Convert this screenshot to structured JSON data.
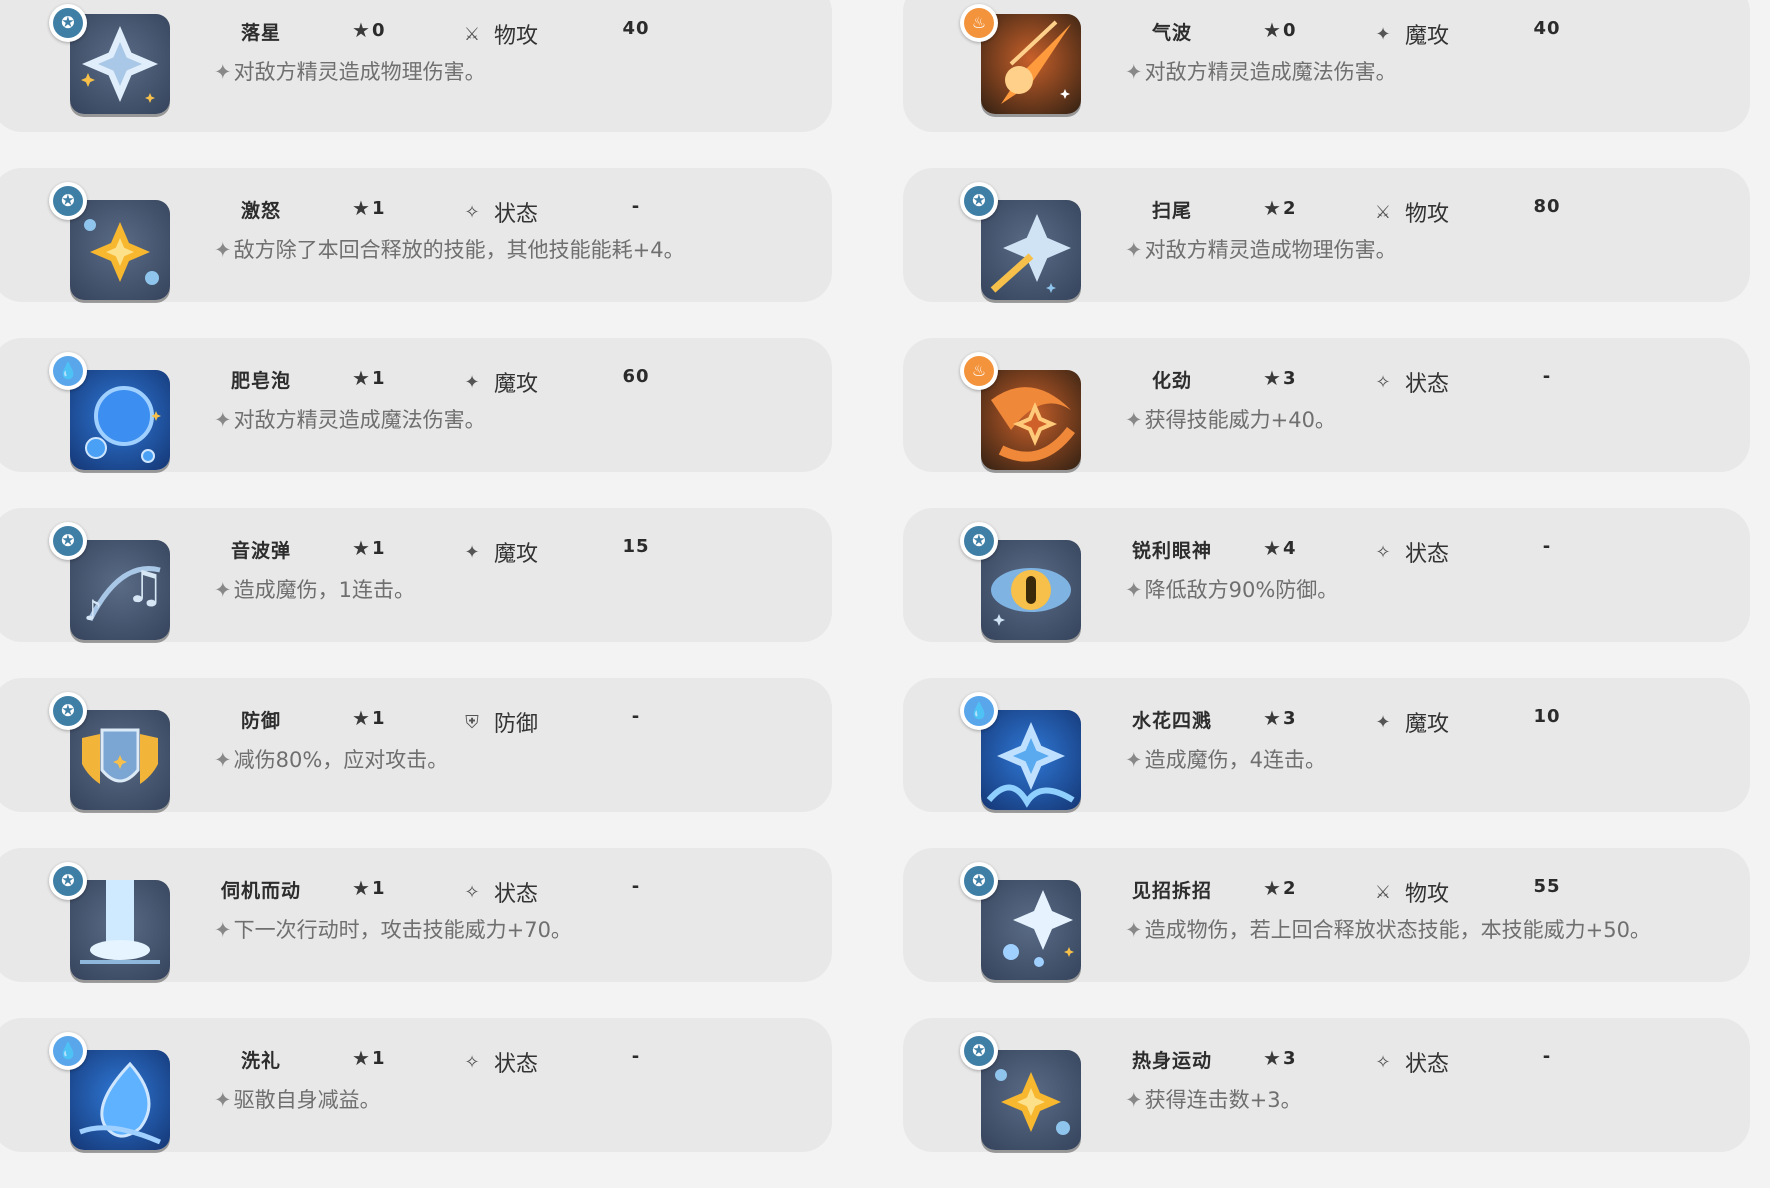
{
  "colors": {
    "card": "#e8e8e8",
    "background": "#f3f3f3",
    "badge_normal": "#3f7fa6",
    "badge_fire": "#f3943d",
    "badge_water": "#5aa6ea"
  },
  "left": [
    {
      "name": "落星",
      "cost": "0",
      "category": "物攻",
      "category_icon": "sword-icon",
      "power": "40",
      "desc": "对敌方精灵造成物理伤害。",
      "element": "normal",
      "art": "star-shatter"
    },
    {
      "name": "激怒",
      "cost": "1",
      "category": "状态",
      "category_icon": "sparkle-icon",
      "power": "-",
      "desc": "敌方除了本回合释放的技能，其他技能能耗+4。",
      "element": "normal",
      "art": "yellow-star"
    },
    {
      "name": "肥皂泡",
      "cost": "1",
      "category": "魔攻",
      "category_icon": "wand-icon",
      "power": "60",
      "desc": "对敌方精灵造成魔法伤害。",
      "element": "water",
      "art": "bubble"
    },
    {
      "name": "音波弹",
      "cost": "1",
      "category": "魔攻",
      "category_icon": "wand-icon",
      "power": "15",
      "desc": "造成魔伤，1连击。",
      "element": "normal",
      "art": "music"
    },
    {
      "name": "防御",
      "cost": "1",
      "category": "防御",
      "category_icon": "shield-icon",
      "power": "-",
      "desc": "减伤80%，应对攻击。",
      "element": "normal",
      "art": "shield"
    },
    {
      "name": "伺机而动",
      "cost": "1",
      "category": "状态",
      "category_icon": "sparkle-icon",
      "power": "-",
      "desc": "下一次行动时，攻击技能威力+70。",
      "element": "normal",
      "art": "light-beam"
    },
    {
      "name": "洗礼",
      "cost": "1",
      "category": "状态",
      "category_icon": "sparkle-icon",
      "power": "-",
      "desc": "驱散自身减益。",
      "element": "water",
      "art": "water-drop"
    }
  ],
  "right": [
    {
      "name": "气波",
      "cost": "0",
      "category": "魔攻",
      "category_icon": "wand-icon",
      "power": "40",
      "desc": "对敌方精灵造成魔法伤害。",
      "element": "fire",
      "art": "comet"
    },
    {
      "name": "扫尾",
      "cost": "2",
      "category": "物攻",
      "category_icon": "sword-icon",
      "power": "80",
      "desc": "对敌方精灵造成物理伤害。",
      "element": "normal",
      "art": "tail-swipe"
    },
    {
      "name": "化劲",
      "cost": "3",
      "category": "状态",
      "category_icon": "sparkle-icon",
      "power": "-",
      "desc": "获得技能威力+40。",
      "element": "fire",
      "art": "fire-swirl"
    },
    {
      "name": "锐利眼神",
      "cost": "4",
      "category": "状态",
      "category_icon": "sparkle-icon",
      "power": "-",
      "desc": "降低敌方90%防御。",
      "element": "normal",
      "art": "eye"
    },
    {
      "name": "水花四溅",
      "cost": "3",
      "category": "魔攻",
      "category_icon": "wand-icon",
      "power": "10",
      "desc": "造成魔伤，4连击。",
      "element": "water",
      "art": "splash"
    },
    {
      "name": "见招拆招",
      "cost": "2",
      "category": "物攻",
      "category_icon": "sword-icon",
      "power": "55",
      "desc": "造成物伤，若上回合释放状态技能，本技能威力+50。",
      "element": "normal",
      "art": "burst"
    },
    {
      "name": "热身运动",
      "cost": "3",
      "category": "状态",
      "category_icon": "sparkle-icon",
      "power": "-",
      "desc": "获得连击数+3。",
      "element": "normal",
      "art": "yellow-star"
    }
  ]
}
